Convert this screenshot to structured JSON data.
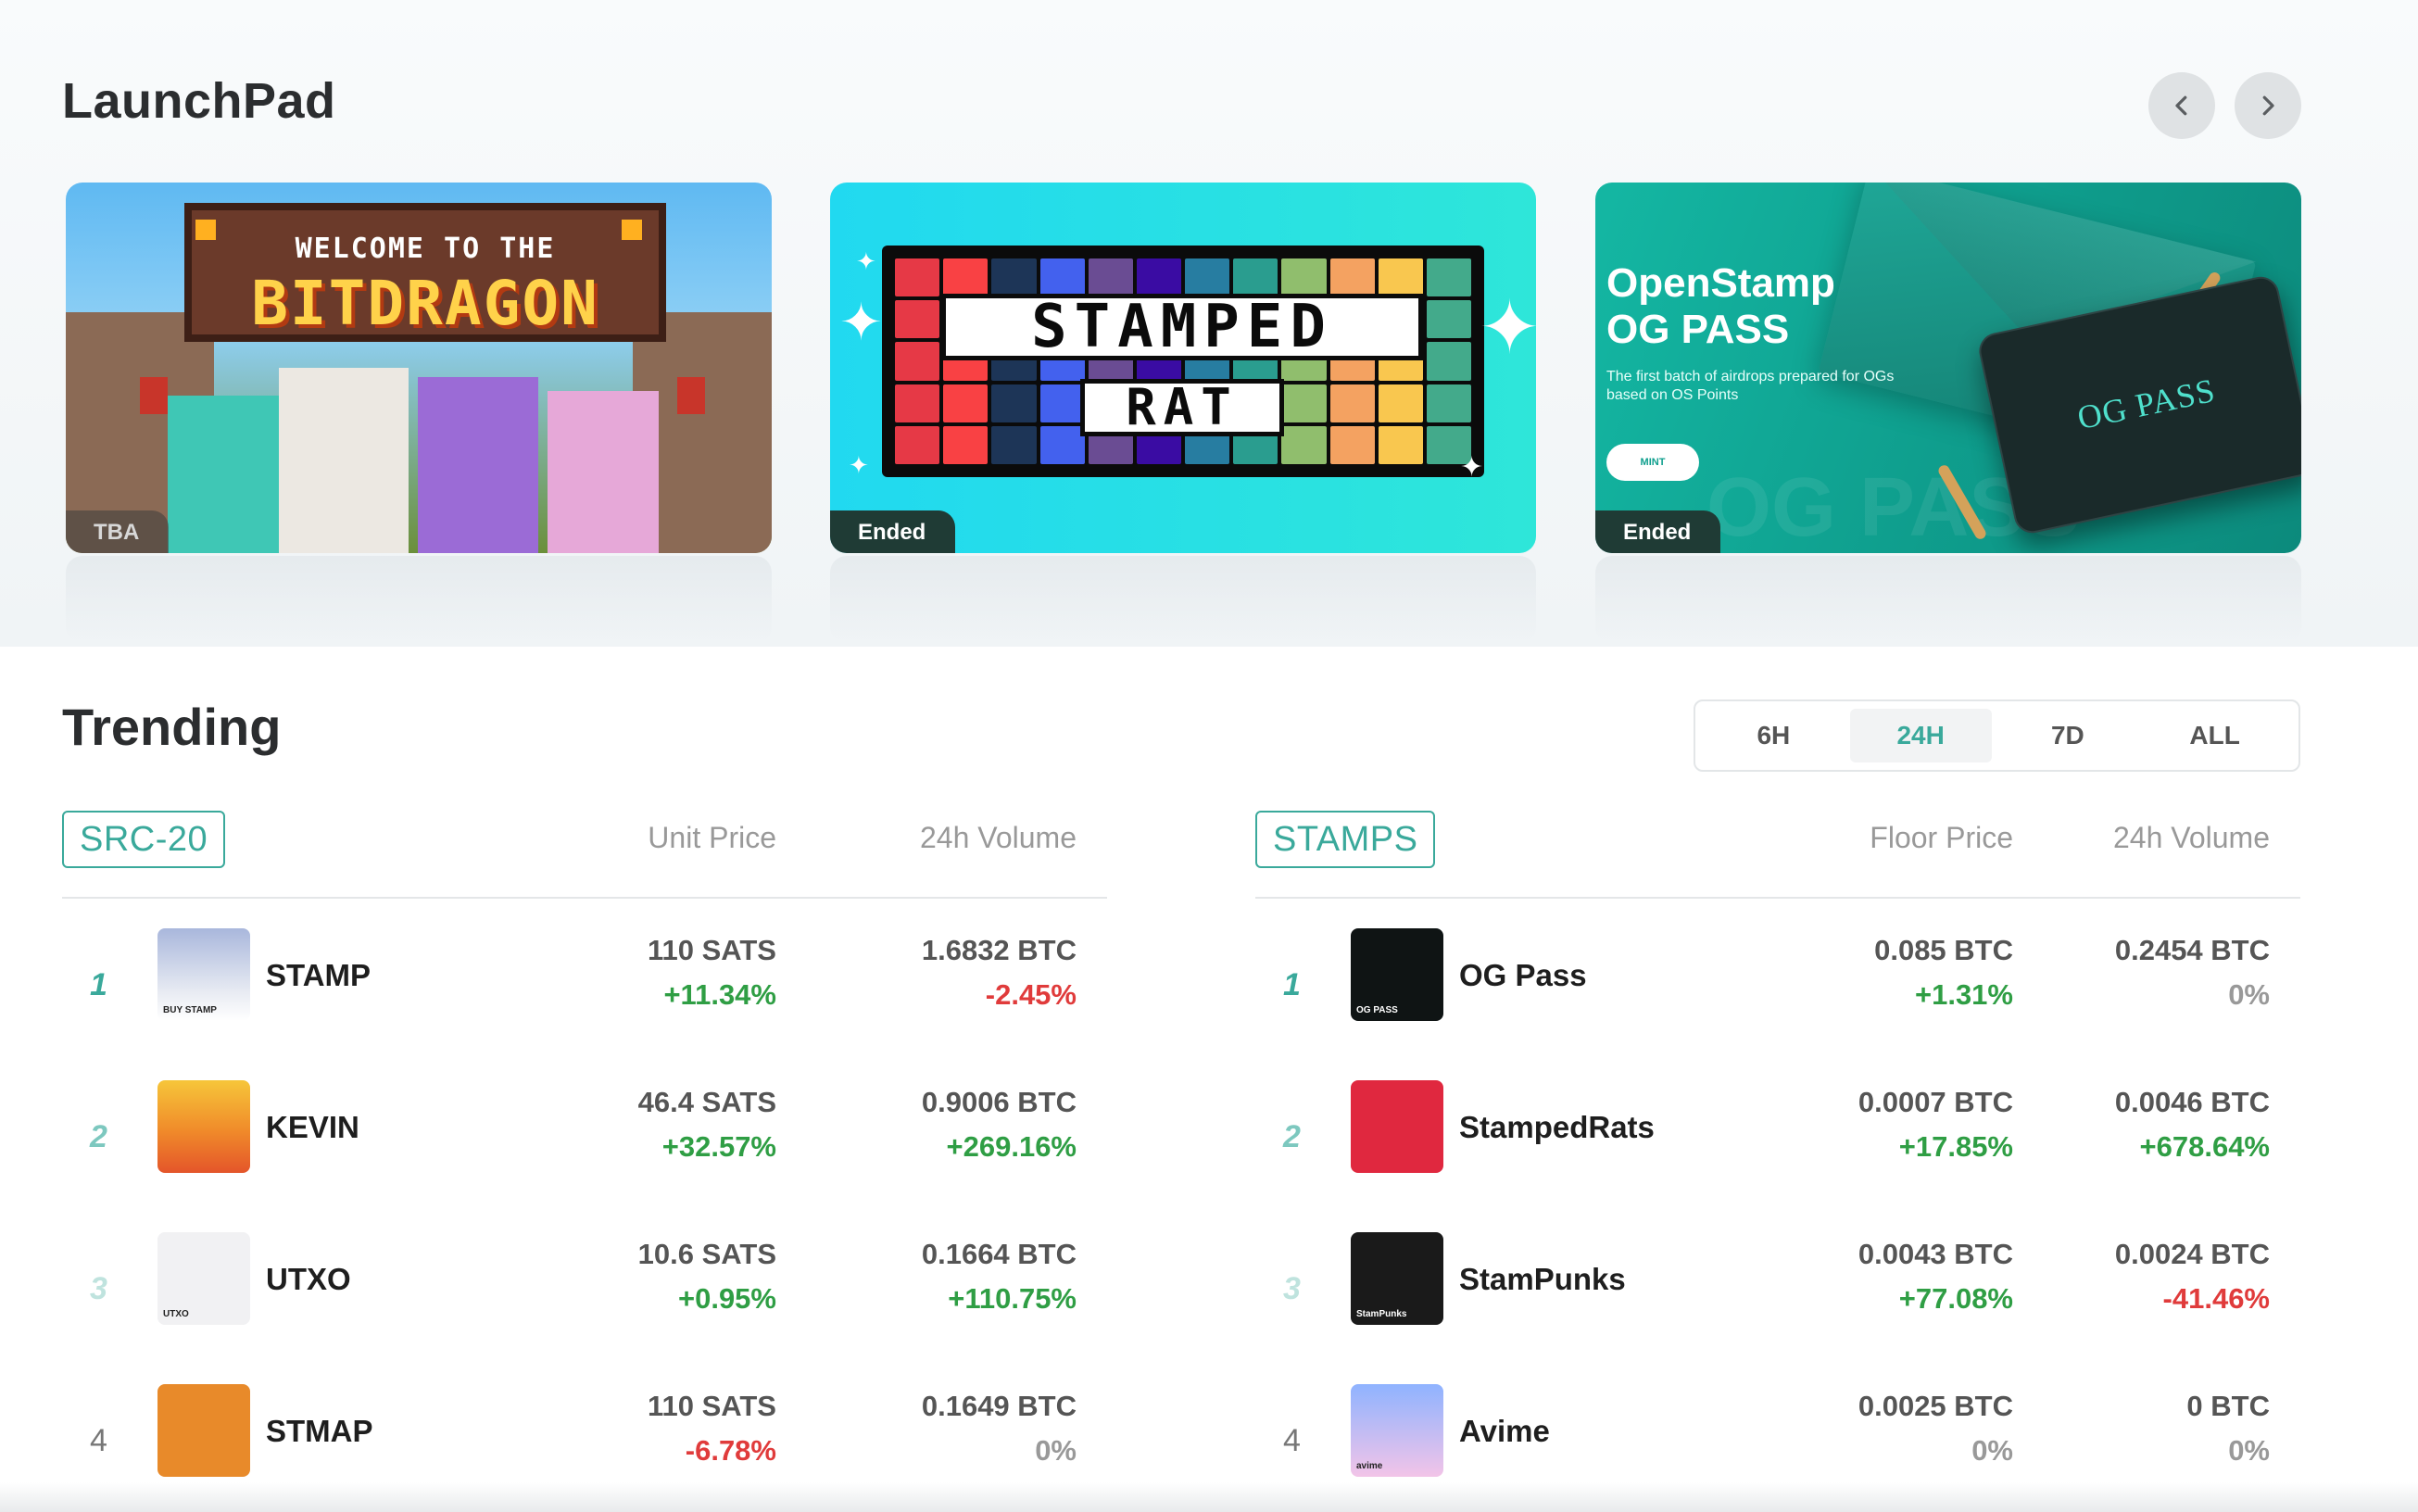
{
  "launchpad": {
    "title": "LaunchPad",
    "prev_icon": "chevron-left-icon",
    "next_icon": "chevron-right-icon",
    "cards": [
      {
        "status": "TBA",
        "art_line1": "WELCOME TO THE",
        "art_line2": "BITDRAGON"
      },
      {
        "status": "Ended",
        "art_line1": "STAMPED",
        "art_line2": "RAT"
      },
      {
        "status": "Ended",
        "art_line1": "OpenStamp",
        "art_line2": "OG PASS",
        "description": "The first batch of airdrops prepared for OGs based on OS Points",
        "button": "MINT",
        "card_text": "OG PASS"
      }
    ]
  },
  "trending": {
    "title": "Trending",
    "tabs": [
      "6H",
      "24H",
      "7D",
      "ALL"
    ],
    "active_tab": "24H",
    "src20": {
      "label": "SRC-20",
      "col1": "Unit Price",
      "col2": "24h Volume",
      "rows": [
        {
          "rank": "1",
          "name": "STAMP",
          "price": "110 SATS",
          "price_change": "+11.34%",
          "volume": "1.6832 BTC",
          "volume_change": "-2.45%"
        },
        {
          "rank": "2",
          "name": "KEVIN",
          "price": "46.4 SATS",
          "price_change": "+32.57%",
          "volume": "0.9006 BTC",
          "volume_change": "+269.16%"
        },
        {
          "rank": "3",
          "name": "UTXO",
          "price": "10.6 SATS",
          "price_change": "+0.95%",
          "volume": "0.1664 BTC",
          "volume_change": "+110.75%"
        },
        {
          "rank": "4",
          "name": "STMAP",
          "price": "110 SATS",
          "price_change": "-6.78%",
          "volume": "0.1649 BTC",
          "volume_change": "0%"
        }
      ],
      "thumb_texts": [
        "BUY STAMP",
        "",
        "UTXO",
        ""
      ]
    },
    "stamps": {
      "label": "STAMPS",
      "col1": "Floor Price",
      "col2": "24h Volume",
      "rows": [
        {
          "rank": "1",
          "name": "OG Pass",
          "price": "0.085 BTC",
          "price_change": "+1.31%",
          "volume": "0.2454 BTC",
          "volume_change": "0%"
        },
        {
          "rank": "2",
          "name": "StampedRats",
          "price": "0.0007 BTC",
          "price_change": "+17.85%",
          "volume": "0.0046 BTC",
          "volume_change": "+678.64%"
        },
        {
          "rank": "3",
          "name": "StamPunks",
          "price": "0.0043 BTC",
          "price_change": "+77.08%",
          "volume": "0.0024 BTC",
          "volume_change": "-41.46%"
        },
        {
          "rank": "4",
          "name": "Avime",
          "price": "0.0025 BTC",
          "price_change": "0%",
          "volume": "0 BTC",
          "volume_change": "0%"
        }
      ],
      "thumb_texts": [
        "OG PASS",
        "",
        "StamPunks",
        "avime"
      ]
    }
  },
  "colors": {
    "accent": "#3aa99b",
    "positive": "#2f9e44",
    "negative": "#e03b3b",
    "neutral": "#999999"
  }
}
